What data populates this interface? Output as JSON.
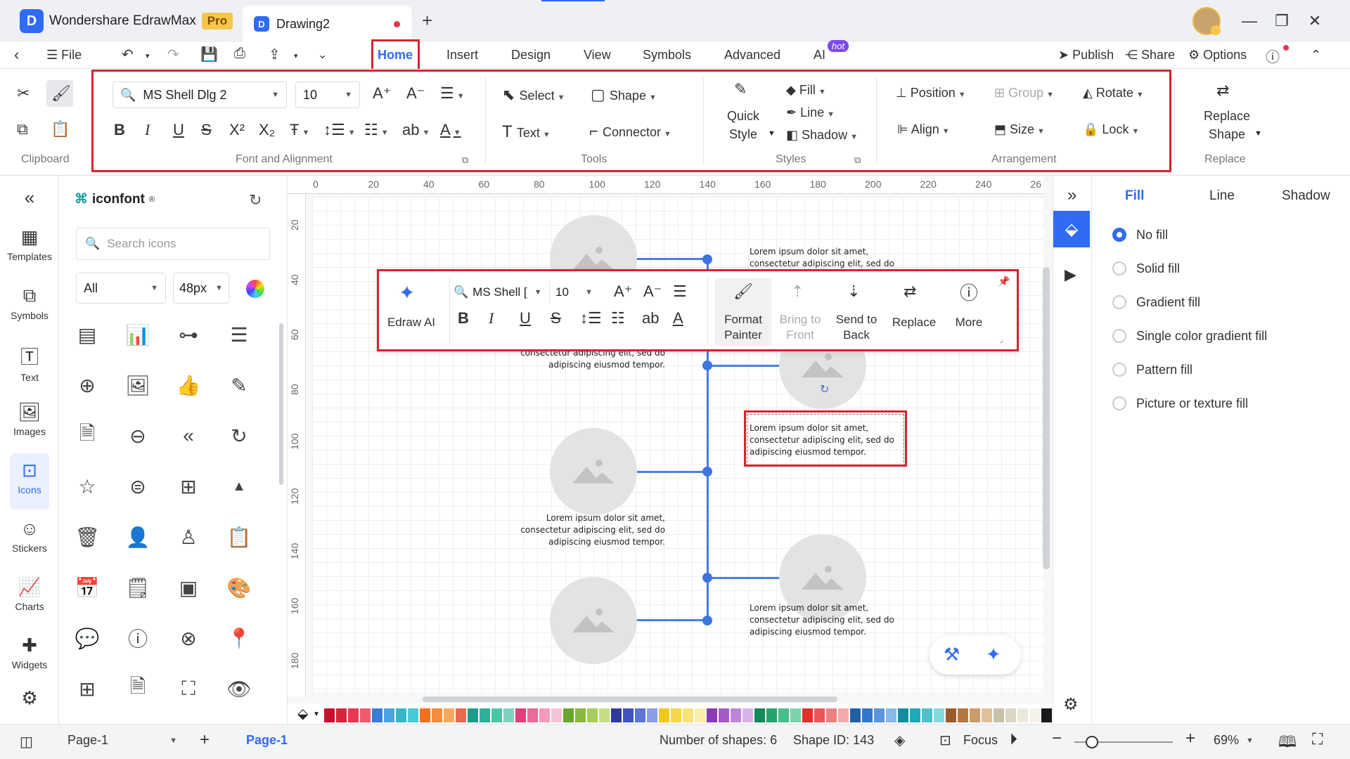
{
  "titlebar": {
    "app_name": "Wondershare EdrawMax",
    "pro_badge": "Pro",
    "doc_tab": "Drawing2",
    "new_tab": "+"
  },
  "menubar": {
    "file": "File",
    "tabs": [
      "Home",
      "Insert",
      "Design",
      "View",
      "Symbols",
      "Advanced",
      "AI"
    ],
    "active_tab": "Home",
    "ai_badge": "hot",
    "publish": "Publish",
    "share": "Share",
    "options": "Options"
  },
  "ribbon": {
    "font_name": "MS Shell Dlg 2",
    "font_size": "10",
    "select": "Select",
    "shape": "Shape",
    "text": "Text",
    "connector": "Connector",
    "quick_style_line1": "Quick",
    "quick_style_line2": "Style",
    "fill": "Fill",
    "line": "Line",
    "shadow": "Shadow",
    "position": "Position",
    "group": "Group",
    "rotate": "Rotate",
    "align": "Align",
    "size": "Size",
    "lock": "Lock",
    "replace_shape_line1": "Replace",
    "replace_shape_line2": "Shape",
    "groups": {
      "clipboard": "Clipboard",
      "font_alignment": "Font and Alignment",
      "tools": "Tools",
      "styles": "Styles",
      "arrangement": "Arrangement",
      "replace": "Replace"
    }
  },
  "leftnav": [
    "Templates",
    "Symbols",
    "Text",
    "Images",
    "Icons",
    "Stickers",
    "Charts",
    "Widgets"
  ],
  "leftnav_active": "Icons",
  "library": {
    "title": "iconfont",
    "reg": "®",
    "search_placeholder": "Search icons",
    "category": "All",
    "size": "48px"
  },
  "ruler_top": [
    "0",
    "20",
    "40",
    "60",
    "80",
    "100",
    "120",
    "140",
    "160",
    "180",
    "200",
    "220",
    "240",
    "26"
  ],
  "ruler_left": [
    "20",
    "40",
    "60",
    "80",
    "100",
    "120",
    "140",
    "160",
    "180"
  ],
  "canvas": {
    "lorem1": "Lorem ipsum dolor sit amet,",
    "lorem2": "consectetur adipiscing elit, sed do",
    "lorem3": "adipiscing eiusmod tempor."
  },
  "floatbar": {
    "edraw_ai": "Edraw AI",
    "font": "MS Shell [",
    "size": "10",
    "format_painter_1": "Format",
    "format_painter_2": "Painter",
    "bring_front_1": "Bring to",
    "bring_front_2": "Front",
    "send_back_1": "Send to",
    "send_back_2": "Back",
    "replace": "Replace",
    "more": "More"
  },
  "rightpanel": {
    "tabs": [
      "Fill",
      "Line",
      "Shadow"
    ],
    "active_tab": "Fill",
    "options": [
      "No fill",
      "Solid fill",
      "Gradient fill",
      "Single color gradient fill",
      "Pattern fill",
      "Picture or texture fill"
    ],
    "selected": "No fill"
  },
  "statusbar": {
    "page_select": "Page-1",
    "page_tab": "Page-1",
    "shape_count": "Number of shapes: 6",
    "shape_id": "Shape ID: 143",
    "focus": "Focus",
    "zoom": "69%"
  },
  "palette_colors": [
    "#c8102e",
    "#d6263a",
    "#e4394e",
    "#ef5b6a",
    "#3a7bd5",
    "#4aa3e0",
    "#35b6c9",
    "#49c9d6",
    "#f2701d",
    "#f58c3a",
    "#f6a95c",
    "#e86a4f",
    "#1f9b8a",
    "#2cb09a",
    "#4fc3a8",
    "#7fd3be",
    "#e0407a",
    "#ea6a9a",
    "#f29bbb",
    "#f6c3d5",
    "#6aa52c",
    "#86b93e",
    "#a6cc5b",
    "#c4dd85",
    "#2d3c9b",
    "#3f55c0",
    "#5d74d9",
    "#8a9de6",
    "#f2c81d",
    "#f5d549",
    "#f8e27a",
    "#fbeeaa",
    "#8a3bb0",
    "#a35bc7",
    "#be85da",
    "#d8b2ea",
    "#138a5a",
    "#25a36f",
    "#48bd8a",
    "#7dd3ab",
    "#e52e2e",
    "#eb5656",
    "#f08080",
    "#f5aaaa",
    "#1f5fa8",
    "#2f78c8",
    "#5897db",
    "#8ab8e8",
    "#0e8fa0",
    "#20a9b8",
    "#4cc2cd",
    "#86d9df",
    "#9a5b2a",
    "#b5773f",
    "#cd9a6a",
    "#e0c09c",
    "#c9c1a8",
    "#dcd6c2",
    "#ece8dc",
    "#f5f2ea",
    "#1a1a1a",
    "#444444",
    "#777777",
    "#aaaaaa",
    "#cccccc",
    "#e6e6e6"
  ]
}
